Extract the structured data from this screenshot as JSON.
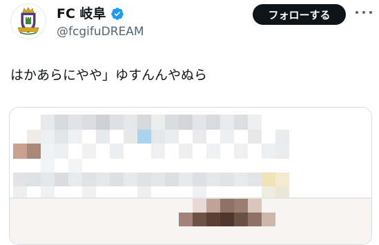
{
  "tweet": {
    "author": {
      "display_name": "FC 岐阜",
      "handle": "@fcgifuDREAM",
      "verified": true,
      "avatar_icon": "club-crest-icon"
    },
    "follow_label": "フォローする",
    "more_icon": "more-options-icon",
    "text": "はかあらにやや」ゆすんんやぬら",
    "media": {
      "type": "pixelated-image"
    }
  },
  "colors": {
    "text_primary": "#0f1419",
    "text_secondary": "#536471",
    "verified_blue": "#1d9bf0",
    "follow_bg": "#0f1419",
    "border": "#d9dde1"
  }
}
